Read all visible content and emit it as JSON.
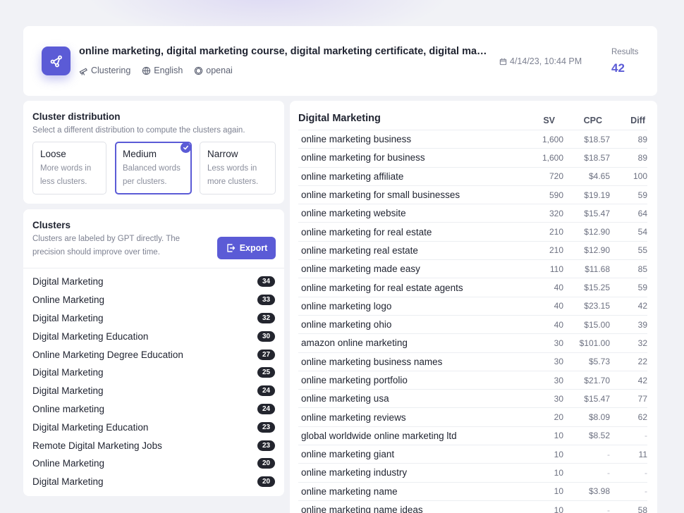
{
  "header": {
    "title": "online marketing, digital marketing course, digital marketing certificate, digital marketing certification",
    "meta": [
      {
        "icon": "telescope-icon",
        "label": "Clustering"
      },
      {
        "icon": "globe-icon",
        "label": "English"
      },
      {
        "icon": "openai-icon",
        "label": "openai"
      }
    ],
    "date": "4/14/23, 10:44 PM",
    "results_label": "Results",
    "results_value": "42"
  },
  "distribution": {
    "title": "Cluster distribution",
    "subtitle": "Select a different distribution to compute the clusters again.",
    "options": [
      {
        "name": "Loose",
        "desc1": "More words in",
        "desc2": "less clusters."
      },
      {
        "name": "Medium",
        "desc1": "Balanced words",
        "desc2": "per clusters."
      },
      {
        "name": "Narrow",
        "desc1": "Less words in",
        "desc2": "more clusters."
      }
    ],
    "selected": "Medium"
  },
  "clusters": {
    "title": "Clusters",
    "subtitle1": "Clusters are labeled by GPT directly. The",
    "subtitle2": "precision should improve over time.",
    "export_label": "Export",
    "items": [
      {
        "label": "Digital Marketing",
        "count": "34"
      },
      {
        "label": "Online Marketing",
        "count": "33"
      },
      {
        "label": "Digital Marketing",
        "count": "32"
      },
      {
        "label": "Digital Marketing Education",
        "count": "30"
      },
      {
        "label": "Online Marketing Degree Education",
        "count": "27"
      },
      {
        "label": "Digital Marketing",
        "count": "25"
      },
      {
        "label": "Digital Marketing",
        "count": "24"
      },
      {
        "label": "Online marketing",
        "count": "24"
      },
      {
        "label": "Digital Marketing Education",
        "count": "23"
      },
      {
        "label": "Remote Digital Marketing Jobs",
        "count": "23"
      },
      {
        "label": "Online Marketing",
        "count": "20"
      },
      {
        "label": "Digital Marketing",
        "count": "20"
      }
    ]
  },
  "table": {
    "title": "Digital Marketing",
    "columns": {
      "sv": "SV",
      "cpc": "CPC",
      "diff": "Diff"
    },
    "rows": [
      {
        "kw": "online marketing business",
        "sv": "1,600",
        "cpc": "$18.57",
        "diff": "89"
      },
      {
        "kw": "online marketing for business",
        "sv": "1,600",
        "cpc": "$18.57",
        "diff": "89"
      },
      {
        "kw": "online marketing affiliate",
        "sv": "720",
        "cpc": "$4.65",
        "diff": "100"
      },
      {
        "kw": "online marketing for small businesses",
        "sv": "590",
        "cpc": "$19.19",
        "diff": "59"
      },
      {
        "kw": "online marketing website",
        "sv": "320",
        "cpc": "$15.47",
        "diff": "64"
      },
      {
        "kw": "online marketing for real estate",
        "sv": "210",
        "cpc": "$12.90",
        "diff": "54"
      },
      {
        "kw": "online marketing real estate",
        "sv": "210",
        "cpc": "$12.90",
        "diff": "55"
      },
      {
        "kw": "online marketing made easy",
        "sv": "110",
        "cpc": "$11.68",
        "diff": "85"
      },
      {
        "kw": "online marketing for real estate agents",
        "sv": "40",
        "cpc": "$15.25",
        "diff": "59"
      },
      {
        "kw": "online marketing logo",
        "sv": "40",
        "cpc": "$23.15",
        "diff": "42"
      },
      {
        "kw": "online marketing ohio",
        "sv": "40",
        "cpc": "$15.00",
        "diff": "39"
      },
      {
        "kw": "amazon online marketing",
        "sv": "30",
        "cpc": "$101.00",
        "diff": "32"
      },
      {
        "kw": "online marketing business names",
        "sv": "30",
        "cpc": "$5.73",
        "diff": "22"
      },
      {
        "kw": "online marketing portfolio",
        "sv": "30",
        "cpc": "$21.70",
        "diff": "42"
      },
      {
        "kw": "online marketing usa",
        "sv": "30",
        "cpc": "$15.47",
        "diff": "77"
      },
      {
        "kw": "online marketing reviews",
        "sv": "20",
        "cpc": "$8.09",
        "diff": "62"
      },
      {
        "kw": "global worldwide online marketing ltd",
        "sv": "10",
        "cpc": "$8.52",
        "diff": "-"
      },
      {
        "kw": "online marketing giant",
        "sv": "10",
        "cpc": "-",
        "diff": "11"
      },
      {
        "kw": "online marketing industry",
        "sv": "10",
        "cpc": "-",
        "diff": "-"
      },
      {
        "kw": "online marketing name",
        "sv": "10",
        "cpc": "$3.98",
        "diff": "-"
      },
      {
        "kw": "online marketing name ideas",
        "sv": "10",
        "cpc": "-",
        "diff": "58"
      }
    ]
  },
  "colors": {
    "accent": "#5b5bd6",
    "badge": "#23252e",
    "background": "#f1f2f6"
  }
}
